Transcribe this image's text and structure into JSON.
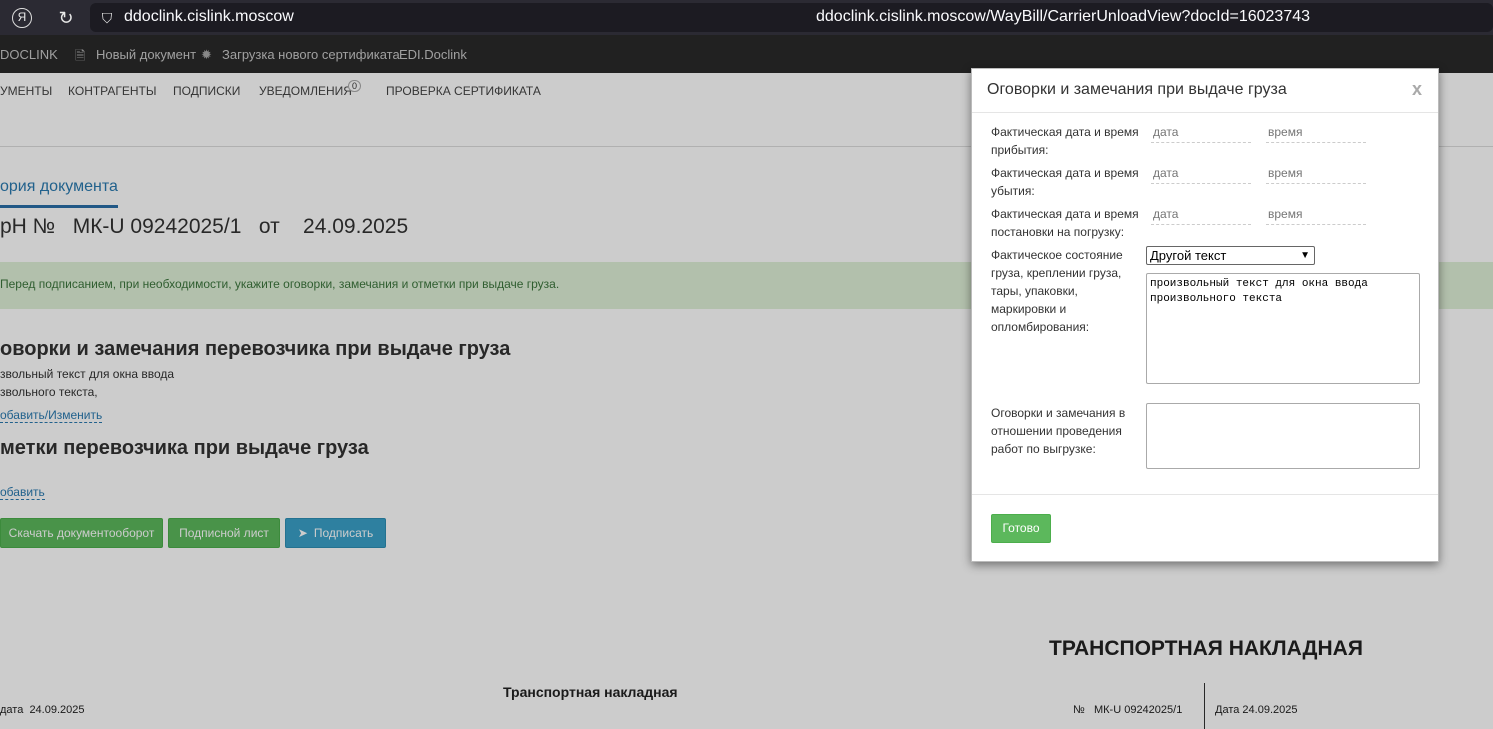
{
  "browser": {
    "logo": "Я",
    "reload": "↻",
    "shield": "⛉",
    "host": "ddoclink.cislink.moscow",
    "url": "ddoclink.cislink.moscow/WayBill/CarrierUnloadView?docId=16023743"
  },
  "app_header": {
    "brand": "DOCLINK",
    "new_doc": "Новый документ",
    "upload_cert": "Загрузка нового сертификата",
    "edi": "EDI.Doclink"
  },
  "nav": {
    "documents": "УМЕНТЫ",
    "contractors": "КОНТРАГЕНТЫ",
    "subscriptions": "ПОДПИСКИ",
    "notifications": "УВЕДОМЛЕНИЯ",
    "notifications_count": "0",
    "cert_check": "ПРОВЕРКА СЕРТИФИКАТА"
  },
  "page": {
    "tab_history": "ория документа",
    "doc_title": "рН №   МК-U 09242025/1   от    24.09.2025",
    "alert": "Перед подписанием, при необходимости, укажите оговорки, замечания и отметки при выдаче груза.",
    "section1_title": "оворки и замечания перевозчика при выдаче груза",
    "section1_line1": "звольный текст для окна ввода",
    "section1_line2": "звольного текста,",
    "section1_link": "обавить/Изменить",
    "section2_title": "метки перевозчика при выдаче груза",
    "section2_link": "обавить",
    "btn_download": "Скачать документооборот",
    "btn_sign_sheet": "Подписной лист",
    "btn_sign": "Подписать",
    "btn_sign_icon": "➤"
  },
  "document": {
    "main_title": "ТРАНСПОРТНАЯ НАКЛАДНАЯ",
    "sub_title": "Транспортная накладная",
    "left_date": "дата  24.09.2025",
    "number": "№   МК-U 09242025/1",
    "right_date": "Дата 24.09.2025"
  },
  "modal": {
    "title": "Оговорки и замечания при выдаче груза",
    "close": "x",
    "fields": {
      "arrival_label": "Фактическая дата и время прибытия:",
      "departure_label": "Фактическая дата и время убытия:",
      "loading_label": "Фактическая дата и время постановки на погрузку:",
      "date_placeholder": "дата",
      "time_placeholder": "время",
      "state_label": "Фактическое состояние груза, креплении груза, тары, упаковки, маркировки и опломбирования:",
      "state_select_value": "Другой текст",
      "state_text": "произвольный текст для окна ввода произвольного текста",
      "remarks_label": "Оговорки и замечания в отношении проведения работ по выгрузке:",
      "remarks_text": ""
    },
    "done_button": "Готово"
  }
}
